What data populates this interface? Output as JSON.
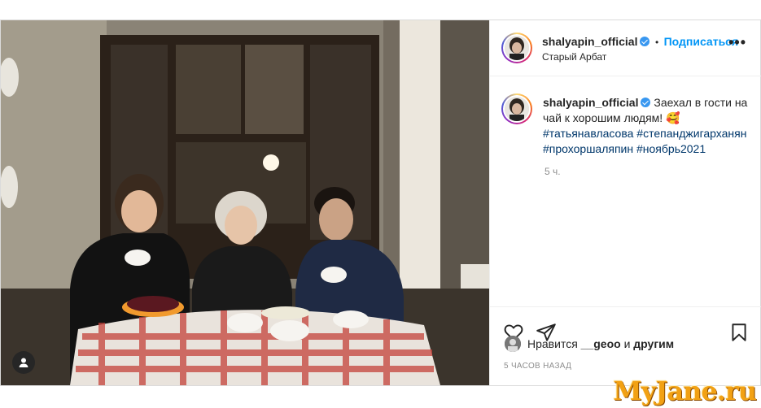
{
  "post": {
    "author": "shalyapin_official",
    "follow_label": "Подписаться",
    "dot": "•",
    "location": "Старый Арбат",
    "more_label": "•••",
    "caption_text": "Заехал в гости на чай к хорошим людям! 🥰",
    "hashtags": [
      "#татьянавласова",
      "#степанджигарханян",
      "#прохоршаляпин",
      "#ноябрь2021"
    ],
    "caption_time": "5 ч.",
    "likes_prefix": "Нравится",
    "likes_user": "__geoo",
    "likes_and": "и",
    "likes_others": "другим",
    "timestamp": "5 ЧАСОВ НАЗАД"
  },
  "icons": {
    "verified": "verified-badge-icon",
    "like": "heart-icon",
    "share": "paper-plane-icon",
    "save": "bookmark-icon",
    "more": "more-options-icon",
    "tags": "user-tag-icon"
  },
  "colors": {
    "accent": "#0095f6",
    "hashtag": "#00376b",
    "muted": "#8e8e8e",
    "watermark": "#f2a114"
  },
  "watermark": "MyJane.ru"
}
